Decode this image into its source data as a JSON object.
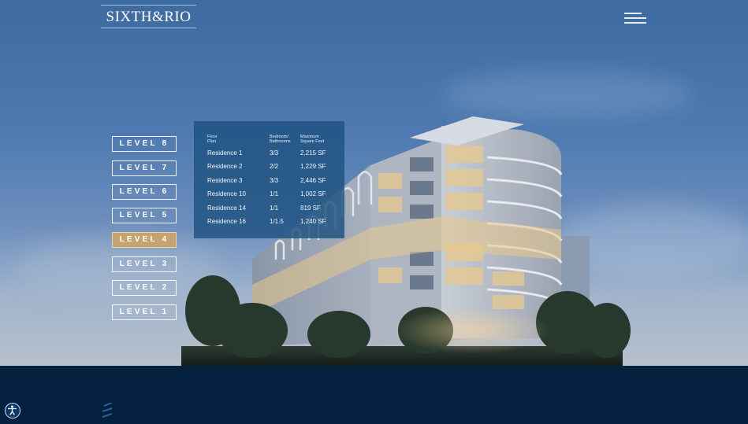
{
  "brand": {
    "logo_text": "SIXTH&RIO"
  },
  "nav": {
    "menu_icon": "hamburger-menu-icon"
  },
  "levels": [
    {
      "label": "LEVEL 8",
      "active": false
    },
    {
      "label": "LEVEL 7",
      "active": false
    },
    {
      "label": "LEVEL 6",
      "active": false
    },
    {
      "label": "LEVEL 5",
      "active": false
    },
    {
      "label": "LEVEL 4",
      "active": true
    },
    {
      "label": "LEVEL 3",
      "active": false
    },
    {
      "label": "LEVEL 2",
      "active": false
    },
    {
      "label": "LEVEL 1",
      "active": false
    }
  ],
  "floor_plan_table": {
    "headers": {
      "plan": "Floor\nPlan",
      "bed_bath": "Bedroom/\nBathrooms",
      "sqft": "Maximum\nSquare Feet"
    },
    "rows": [
      {
        "plan": "Residence 1",
        "bed_bath": "3/3",
        "sqft": "2,215 SF"
      },
      {
        "plan": "Residence 2",
        "bed_bath": "2/2",
        "sqft": "1,229 SF"
      },
      {
        "plan": "Residence 3",
        "bed_bath": "3/3",
        "sqft": "2,446 SF"
      },
      {
        "plan": "Residence 10",
        "bed_bath": "1/1",
        "sqft": "1,002 SF"
      },
      {
        "plan": "Residence 14",
        "bed_bath": "1/1",
        "sqft": "819 SF"
      },
      {
        "plan": "Residence 16",
        "bed_bath": "1/1.5",
        "sqft": "1,240 SF"
      }
    ]
  },
  "colors": {
    "highlight_gold": "#c7a46f",
    "panel_blue": "#1d5280",
    "footer_navy": "#04203f"
  },
  "accessibility": {
    "icon": "accessibility-icon"
  }
}
